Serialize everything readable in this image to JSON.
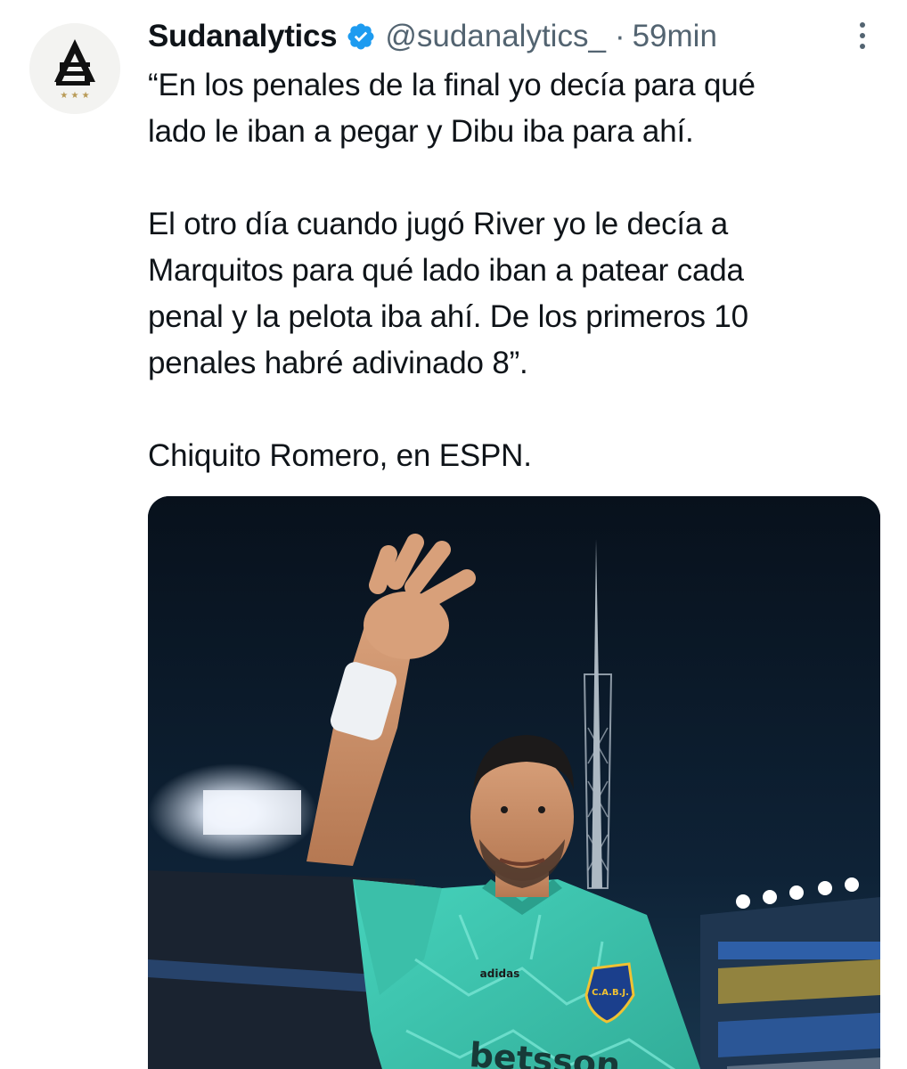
{
  "tweet": {
    "author": {
      "display_name": "Sudanalytics",
      "verified": true,
      "handle": "@sudanalytics_",
      "avatar_icon": "sudanalytics-logo-icon"
    },
    "separator": "·",
    "timestamp": "59min",
    "text": "“En los penales de la final yo decía para qué\nlado le iban a pegar y Dibu iba para ahí.\n\nEl otro día cuando jugó River yo le decía a\nMarquitos para qué lado iban a patear cada\npenal y la pelota iba ahí. De los primeros 10\npenales habré adivinado 8”.\n\nChiquito Romero, en ESPN.",
    "more_icon": "more-options-icon",
    "media": {
      "kind": "photo",
      "shirt_sponsor": "betsson",
      "kit_brand": "adidas",
      "crest": "C.A.B.J."
    }
  },
  "colors": {
    "text": "#0f1419",
    "secondary_text": "#536471",
    "verified_badge": "#1d9bf0",
    "jersey": "#3fc9b2",
    "night_sky": "#0b1522"
  }
}
